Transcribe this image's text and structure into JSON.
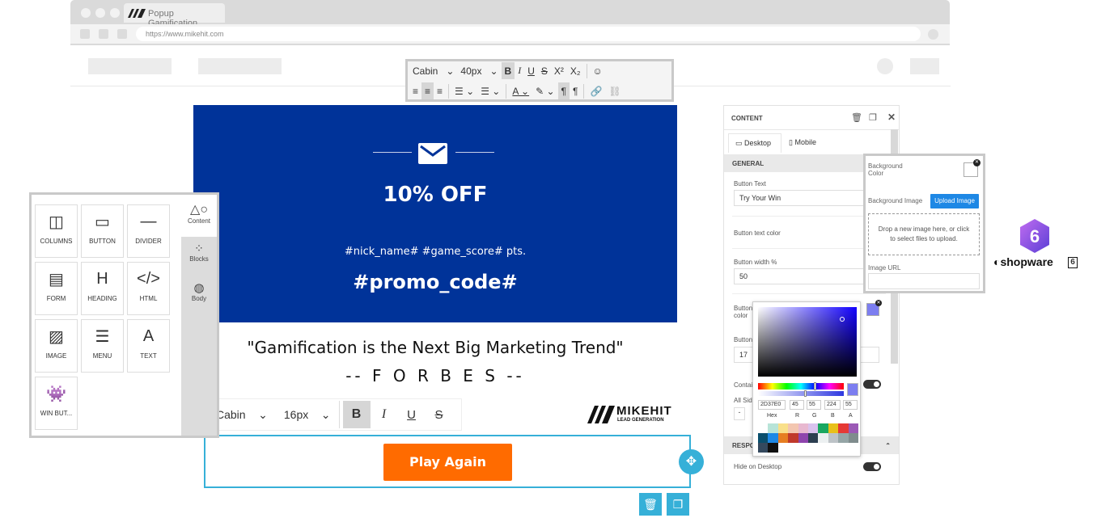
{
  "browser": {
    "tab_title": "Popup Gamification",
    "url": "https://www.mikehit.com"
  },
  "text_toolbar": {
    "font": "Cabin",
    "size": "40px"
  },
  "hero": {
    "discount": "10% OFF",
    "placeholders": "#nick_name# #game_score# pts.",
    "promo": "#promo_code#",
    "bg_color": "#003399"
  },
  "quote": "\"Gamification is the Next Big Marketing Trend\"",
  "attribution": "-- F O R B E S --",
  "toolbar2": {
    "font": "Cabin",
    "size": "16px"
  },
  "brand": {
    "name": "MIKEHIT",
    "tagline": "LEAD GENERATION"
  },
  "play_button": {
    "label": "Play Again",
    "color": "#ff6b00"
  },
  "blocks": [
    {
      "label": "COLUMNS",
      "icon": "columns-icon"
    },
    {
      "label": "BUTTON",
      "icon": "button-icon"
    },
    {
      "label": "DIVIDER",
      "icon": "divider-icon"
    },
    {
      "label": "FORM",
      "icon": "form-icon"
    },
    {
      "label": "HEADING",
      "icon": "heading-icon"
    },
    {
      "label": "HTML",
      "icon": "html-icon"
    },
    {
      "label": "IMAGE",
      "icon": "image-icon"
    },
    {
      "label": "MENU",
      "icon": "menu-icon"
    },
    {
      "label": "TEXT",
      "icon": "text-icon"
    },
    {
      "label": "WIN BUT...",
      "icon": "invader-icon"
    }
  ],
  "side_tabs": [
    "Content",
    "Blocks",
    "Body"
  ],
  "content_panel": {
    "title": "CONTENT",
    "desktop_tab": "Desktop",
    "mobile_tab": "Mobile",
    "general": "GENERAL",
    "button_text_label": "Button Text",
    "button_text_value": "Try Your Win",
    "button_text_color_label": "Button text color",
    "button_width_label": "Button width %",
    "button_width_value": "50",
    "button_color_label": "Button color",
    "button_label_short": "Button",
    "button_value2": "17",
    "contain_label": "Contain",
    "all_sides_label": "All Sides",
    "responsive": "RESPON",
    "hide_desktop": "Hide on Desktop"
  },
  "color_picker": {
    "hex": "2D37E0",
    "r": "45",
    "g": "55",
    "b": "224",
    "a": "55",
    "labels": [
      "Hex",
      "R",
      "G",
      "B",
      "A"
    ],
    "swatches": [
      "#ffffff",
      "#b8e4d8",
      "#f9e08a",
      "#f3c6b0",
      "#e8b8d0",
      "#d9c2ee",
      "#19a760",
      "#e8c01a",
      "#e53935",
      "#9b59b6",
      "#0a4f6d",
      "#1e88e5",
      "#e67e22",
      "#c0392b",
      "#8e44ad",
      "#2c3e50",
      "#ecf0f1",
      "#bdc3c7",
      "#95a5a6",
      "#7f8c8d",
      "#34495e",
      "#111111",
      "#ffffff"
    ]
  },
  "bg_panel": {
    "bg_color_label": "Background Color",
    "bg_image_label": "Background Image",
    "upload_label": "Upload Image",
    "drop_text": "Drop a new image here, or click to select files to upload.",
    "image_url_label": "Image URL"
  },
  "shopware": {
    "name": "shopware",
    "version": "6"
  }
}
